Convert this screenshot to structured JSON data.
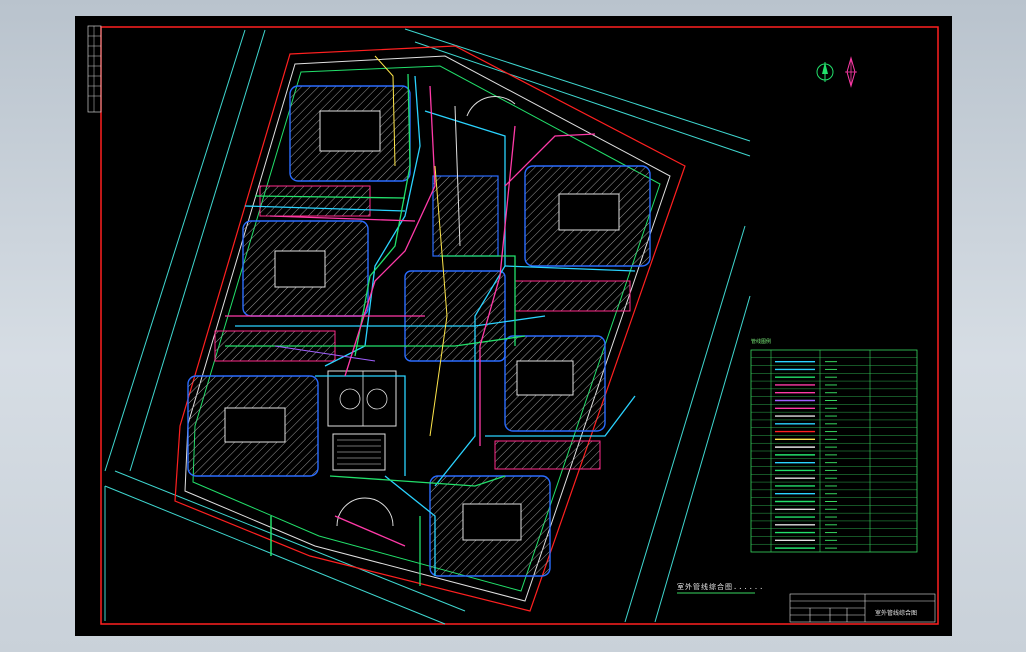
{
  "drawing": {
    "caption": "室外管线综合图......",
    "title_block_name": "室外管线综合图",
    "legend_title": "管线图例"
  },
  "colors": {
    "sheet_background": "#000000",
    "border": "#ff2020",
    "building_outline": "#ff2a8a",
    "water_supply": "#2ad3ff",
    "drainage": "#22e06b",
    "gas": "#ff3aa8",
    "road": "#3fd7d0",
    "legend_grid": "#37d65f"
  },
  "icons": [
    "north-arrow-icon",
    "compass-rose-icon"
  ]
}
